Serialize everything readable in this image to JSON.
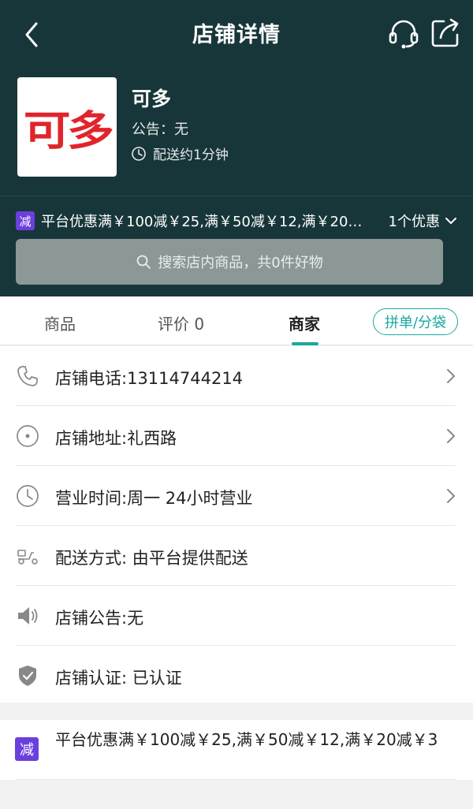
{
  "nav": {
    "title": "店铺详情"
  },
  "shop": {
    "logo_text": "可多",
    "name": "可多",
    "notice": "公告：无",
    "delivery_time": "配送约1分钟"
  },
  "promo": {
    "badge": "减",
    "summary": "平台优惠满￥100减￥25,满￥50减￥12,满￥20减￥3",
    "count_label": "1个优惠"
  },
  "search": {
    "placeholder": "搜索店内商品，共0件好物"
  },
  "tabs": [
    {
      "label": "商品"
    },
    {
      "label": "评价 0"
    },
    {
      "label": "商家"
    }
  ],
  "pin_button": "拼单/分袋",
  "info": [
    {
      "label": "店铺电话:13114744214"
    },
    {
      "label": "店铺地址:礼西路"
    },
    {
      "label": "营业时间:周一 24小时营业"
    },
    {
      "label": "配送方式: 由平台提供配送"
    },
    {
      "label": "店铺公告:无"
    },
    {
      "label": "店铺认证: 已认证"
    }
  ],
  "promo_card": {
    "badge": "减",
    "text": "平台优惠满￥100减￥25,满￥50减￥12,满￥20减￥3"
  },
  "colors": {
    "header_bg": "#17363a",
    "accent": "#1aa8a0",
    "promo_badge": "#6b3fdd",
    "logo_red": "#e1242b"
  }
}
